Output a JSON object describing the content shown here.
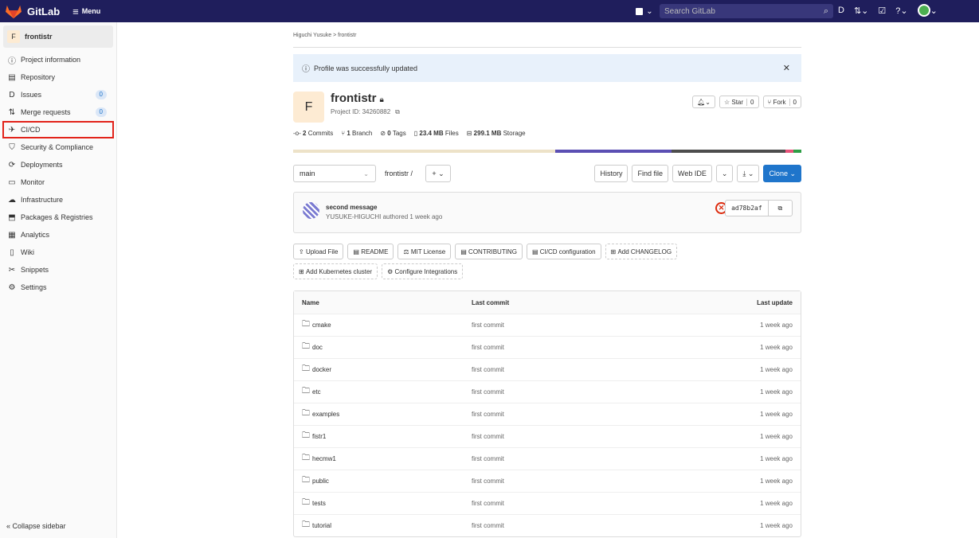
{
  "topbar": {
    "brand": "GitLab",
    "menu_label": "Menu",
    "search_placeholder": "Search GitLab"
  },
  "sidebar": {
    "project_initial": "F",
    "project_name": "frontistr",
    "items": [
      {
        "label": "Project information",
        "icon": "info-icon"
      },
      {
        "label": "Repository",
        "icon": "document-icon"
      },
      {
        "label": "Issues",
        "icon": "issues-icon",
        "badge": "0"
      },
      {
        "label": "Merge requests",
        "icon": "merge-request-icon",
        "badge": "0"
      },
      {
        "label": "CI/CD",
        "icon": "rocket-icon",
        "highlighted": true
      },
      {
        "label": "Security & Compliance",
        "icon": "shield-icon"
      },
      {
        "label": "Deployments",
        "icon": "deployments-icon"
      },
      {
        "label": "Monitor",
        "icon": "monitor-icon"
      },
      {
        "label": "Infrastructure",
        "icon": "cloud-icon"
      },
      {
        "label": "Packages & Registries",
        "icon": "package-icon"
      },
      {
        "label": "Analytics",
        "icon": "chart-icon"
      },
      {
        "label": "Wiki",
        "icon": "book-icon"
      },
      {
        "label": "Snippets",
        "icon": "scissors-icon"
      },
      {
        "label": "Settings",
        "icon": "gear-icon"
      }
    ],
    "collapse_label": "Collapse sidebar"
  },
  "breadcrumb": {
    "owner": "Higuchi Yusuke",
    "sep": ">",
    "project": "frontistr"
  },
  "alert": {
    "text": "Profile was successfully updated"
  },
  "project": {
    "initial": "F",
    "name": "frontistr",
    "project_id": "Project ID: 34260882",
    "star_label": "Star",
    "star_count": "0",
    "fork_label": "Fork",
    "fork_count": "0"
  },
  "stats": {
    "commits_count": "2",
    "commits_label": "Commits",
    "branch_count": "1",
    "branch_label": "Branch",
    "tags_count": "0",
    "tags_label": "Tags",
    "files_size": "23.4 MB",
    "files_label": "Files",
    "storage_size": "299.1 MB",
    "storage_label": "Storage"
  },
  "language_bar": [
    {
      "fraction": 0.515,
      "color": "#ede2c8"
    },
    {
      "fraction": 0.23,
      "color": "#5b4fb3"
    },
    {
      "fraction": 0.224,
      "color": "#4d4d4d"
    },
    {
      "fraction": 0.016,
      "color": "#e8537a"
    },
    {
      "fraction": 0.015,
      "color": "#2d9e45"
    }
  ],
  "controls": {
    "branch": "main",
    "path": "frontistr /",
    "history": "History",
    "find_file": "Find file",
    "web_ide": "Web IDE",
    "clone": "Clone"
  },
  "last_commit": {
    "title": "second message",
    "meta": "YUSUKE-HIGUCHI authored 1 week ago",
    "sha": "ad78b2af"
  },
  "quick_actions": [
    {
      "label": "Upload File",
      "icon": "upload-icon",
      "dashed": false
    },
    {
      "label": "README",
      "icon": "file-icon",
      "dashed": false
    },
    {
      "label": "MIT License",
      "icon": "scale-icon",
      "dashed": false
    },
    {
      "label": "CONTRIBUTING",
      "icon": "file-icon",
      "dashed": false
    },
    {
      "label": "CI/CD configuration",
      "icon": "file-icon",
      "dashed": false
    },
    {
      "label": "Add CHANGELOG",
      "icon": "plus-square-icon",
      "dashed": true
    },
    {
      "label": "Add Kubernetes cluster",
      "icon": "plus-square-icon",
      "dashed": true
    },
    {
      "label": "Configure Integrations",
      "icon": "gear-icon",
      "dashed": true
    }
  ],
  "file_table": {
    "headers": [
      "Name",
      "Last commit",
      "Last update"
    ],
    "rows": [
      {
        "name": "cmake",
        "commit": "first commit",
        "updated": "1 week ago"
      },
      {
        "name": "doc",
        "commit": "first commit",
        "updated": "1 week ago"
      },
      {
        "name": "docker",
        "commit": "first commit",
        "updated": "1 week ago"
      },
      {
        "name": "etc",
        "commit": "first commit",
        "updated": "1 week ago"
      },
      {
        "name": "examples",
        "commit": "first commit",
        "updated": "1 week ago"
      },
      {
        "name": "fistr1",
        "commit": "first commit",
        "updated": "1 week ago"
      },
      {
        "name": "hecmw1",
        "commit": "first commit",
        "updated": "1 week ago"
      },
      {
        "name": "public",
        "commit": "first commit",
        "updated": "1 week ago"
      },
      {
        "name": "tests",
        "commit": "first commit",
        "updated": "1 week ago"
      },
      {
        "name": "tutorial",
        "commit": "first commit",
        "updated": "1 week ago"
      }
    ]
  }
}
